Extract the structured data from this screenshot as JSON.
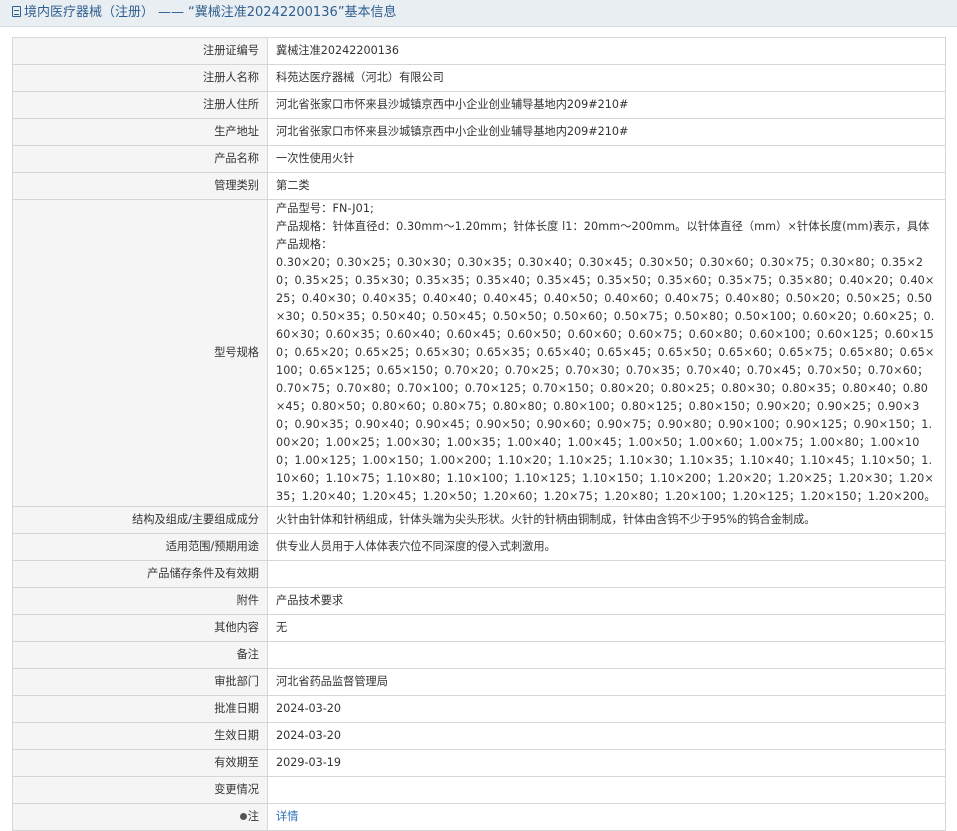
{
  "header": {
    "crumb_category": "境内医疗器械（注册）",
    "separator": "——",
    "record_title": "“冀械注准20242200136”基本信息"
  },
  "rows": {
    "reg_no": {
      "label": "注册证编号",
      "value": "冀械注准20242200136"
    },
    "registrant": {
      "label": "注册人名称",
      "value": "科苑达医疗器械（河北）有限公司"
    },
    "registrant_address": {
      "label": "注册人住所",
      "value": "河北省张家口市怀来县沙城镇京西中小企业创业辅导基地内209#210#"
    },
    "production_address": {
      "label": "生产地址",
      "value": "河北省张家口市怀来县沙城镇京西中小企业创业辅导基地内209#210#"
    },
    "product_name": {
      "label": "产品名称",
      "value": "一次性使用火针"
    },
    "mgmt_class": {
      "label": "管理类别",
      "value": "第二类"
    },
    "model_spec": {
      "label": "型号规格",
      "line1": "产品型号：FN-J01;",
      "line2": "产品规格：针体直径d：0.30mm～1.20mm；针体长度 l1：20mm～200mm。以针体直径（mm）×针体长度(mm)表示，具体产品规格：",
      "list": "0.30×20；0.30×25；0.30×30；0.30×35；0.30×40；0.30×45；0.30×50；0.30×60；0.30×75；0.30×80；0.35×20；0.35×25；0.35×30；0.35×35；0.35×40；0.35×45；0.35×50；0.35×60；0.35×75；0.35×80；0.40×20；0.40×25；0.40×30；0.40×35；0.40×40；0.40×45；0.40×50；0.40×60；0.40×75；0.40×80；0.50×20；0.50×25；0.50×30；0.50×35；0.50×40；0.50×45；0.50×50；0.50×60；0.50×75；0.50×80；0.50×100；0.60×20；0.60×25；0.60×30；0.60×35；0.60×40；0.60×45；0.60×50；0.60×60；0.60×75；0.60×80；0.60×100；0.60×125；0.60×150；0.65×20；0.65×25；0.65×30；0.65×35；0.65×40；0.65×45；0.65×50；0.65×60；0.65×75；0.65×80；0.65×100；0.65×125；0.65×150；0.70×20；0.70×25；0.70×30；0.70×35；0.70×40；0.70×45；0.70×50；0.70×60；0.70×75；0.70×80；0.70×100；0.70×125；0.70×150；0.80×20；0.80×25；0.80×30；0.80×35；0.80×40；0.80×45；0.80×50；0.80×60；0.80×75；0.80×80；0.80×100；0.80×125；0.80×150；0.90×20；0.90×25；0.90×30；0.90×35；0.90×40；0.90×45；0.90×50；0.90×60；0.90×75；0.90×80；0.90×100；0.90×125；0.90×150；1.00×20；1.00×25；1.00×30；1.00×35；1.00×40；1.00×45；1.00×50；1.00×60；1.00×75；1.00×80；1.00×100；1.00×125；1.00×150；1.00×200；1.10×20；1.10×25；1.10×30；1.10×35；1.10×40；1.10×45；1.10×50；1.10×60；1.10×75；1.10×80；1.10×100；1.10×125；1.10×150；1.10×200；1.20×20；1.20×25；1.20×30；1.20×35；1.20×40；1.20×45；1.20×50；1.20×60；1.20×75；1.20×80；1.20×100；1.20×125；1.20×150；1.20×200。"
    },
    "structure": {
      "label": "结构及组成/主要组成成分",
      "value": "火针由针体和针柄组成，针体头端为尖头形状。火针的针柄由铜制成，针体由含钨不少于95%的钨合金制成。"
    },
    "intended_use": {
      "label": "适用范围/预期用途",
      "value": "供专业人员用于人体体表穴位不同深度的侵入式刺激用。"
    },
    "storage": {
      "label": "产品储存条件及有效期",
      "value": ""
    },
    "attachment": {
      "label": "附件",
      "value": "产品技术要求"
    },
    "other": {
      "label": "其他内容",
      "value": "无"
    },
    "remarks": {
      "label": "备注",
      "value": ""
    },
    "approval_dept": {
      "label": "审批部门",
      "value": "河北省药品监督管理局"
    },
    "approval_date": {
      "label": "批准日期",
      "value": "2024-03-20"
    },
    "effective_date": {
      "label": "生效日期",
      "value": "2024-03-20"
    },
    "valid_until": {
      "label": "有效期至",
      "value": "2029-03-19"
    },
    "change_info": {
      "label": "变更情况",
      "value": ""
    },
    "note": {
      "label": "注",
      "value": "详情"
    }
  },
  "icons": {
    "title_icon": "document-icon",
    "note_icon": "pin-icon"
  },
  "colors": {
    "link": "#2c6fb8",
    "title": "#2f5f8f",
    "label_bg": "#f5f5f5",
    "header_bg": "#e9eef3"
  }
}
